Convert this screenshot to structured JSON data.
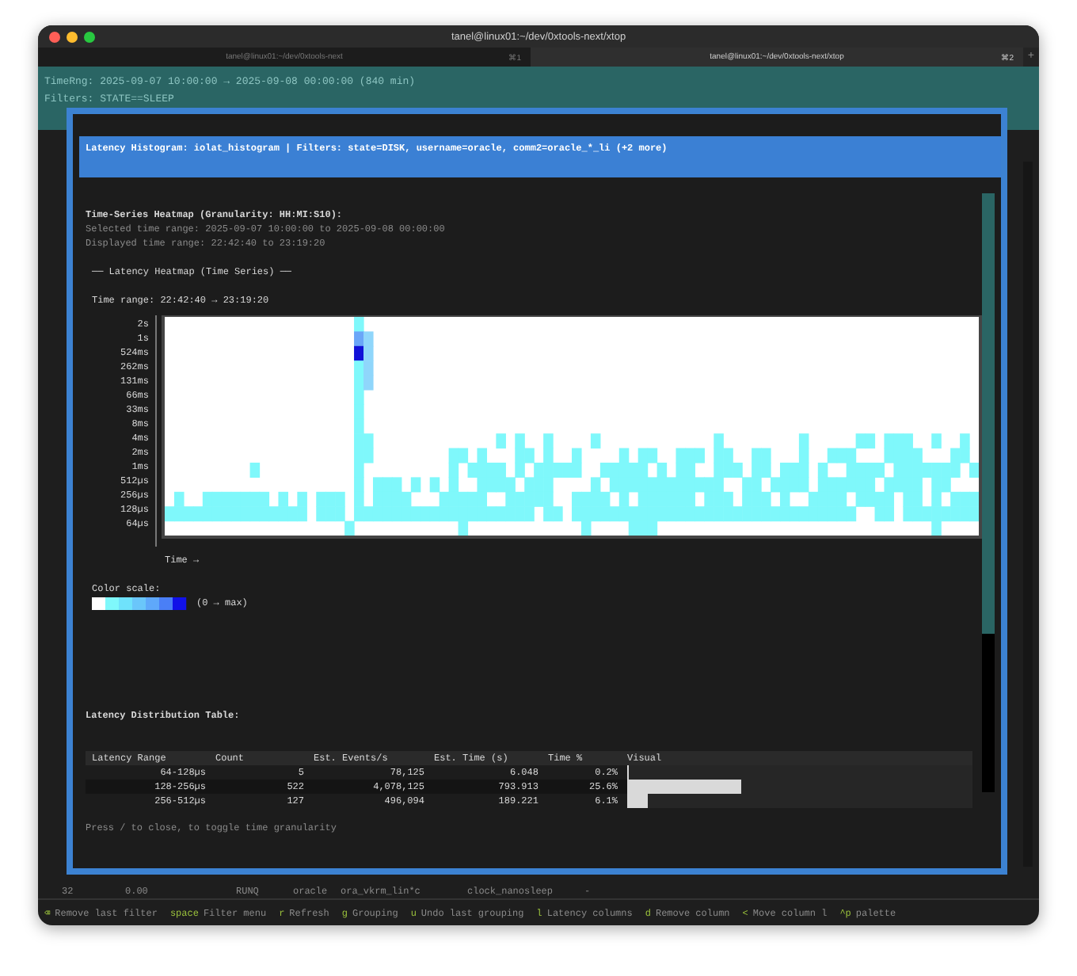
{
  "window": {
    "title": "tanel@linux01:~/dev/0xtools-next/xtop",
    "tabs": [
      {
        "label": "tanel@linux01:~/dev/0xtools-next",
        "shortcut": "⌘1",
        "selected": false
      },
      {
        "label": "tanel@linux01:~/dev/0xtools-next/xtop",
        "shortcut": "⌘2",
        "selected": true
      }
    ],
    "new_tab": "+"
  },
  "background": {
    "lines": [
      "TimeRng: 2025-09-07 10:00:00 → 2025-09-08 00:00:00 (840 min)",
      "Filters: STATE==SLEEP"
    ],
    "row": [
      "32",
      "0.00",
      "RUNQ",
      "oracle",
      "ora_vkrm_lin*c",
      "clock_nanosleep",
      "-"
    ]
  },
  "modal": {
    "header": "Latency Histogram: iolat_histogram | Filters: state=DISK, username=oracle, comm2=oracle_*_li (+2 more)",
    "heatmap_title": "Time-Series Heatmap (Granularity: HH:MI:S10):",
    "selected_range": "Selected time range: 2025-09-07 10:00:00 to 2025-09-08 00:00:00",
    "displayed_range": "Displayed time range: 22:42:40 to 23:19:20",
    "section_title": "── Latency Heatmap (Time Series) ──",
    "time_range": "Time range: 22:42:40 → 23:19:20",
    "y_labels": [
      "2s",
      "1s",
      "524ms",
      "262ms",
      "131ms",
      "66ms",
      "33ms",
      "8ms",
      "4ms",
      "2ms",
      "1ms",
      "512µs",
      "256µs",
      "128µs",
      "64µs"
    ],
    "x_label": "Time →",
    "scale_label": "Color scale:",
    "scale_hint": "(0 → max)",
    "table_title": "Latency Distribution Table:",
    "table": {
      "columns": [
        "Latency Range",
        "Count",
        "Est. Events/s",
        "Est. Time (s)",
        "Time %",
        "Visual"
      ],
      "rows": [
        {
          "cells": [
            "64-128µs",
            "5",
            "78,125",
            "6.048",
            "0.2%"
          ],
          "level": 0.004
        },
        {
          "cells": [
            "128-256µs",
            "522",
            "4,078,125",
            "793.913",
            "25.6%"
          ],
          "level": 0.33
        },
        {
          "cells": [
            "256-512µs",
            "127",
            "496,094",
            "189.221",
            "6.1%"
          ],
          "level": 0.06
        }
      ]
    },
    "hint": "Press / to close,  to toggle time granularity"
  },
  "footer": [
    {
      "key": "⌫",
      "label": "Remove last filter"
    },
    {
      "key": "space",
      "label": "Filter menu"
    },
    {
      "key": "r",
      "label": "Refresh"
    },
    {
      "key": "g",
      "label": "Grouping"
    },
    {
      "key": "u",
      "label": "Undo last grouping"
    },
    {
      "key": "l",
      "label": "Latency columns"
    },
    {
      "key": "d",
      "label": "Remove column"
    },
    {
      "key": "<",
      "label": "Move column l"
    },
    {
      "key": "^p",
      "label": "palette"
    }
  ]
}
